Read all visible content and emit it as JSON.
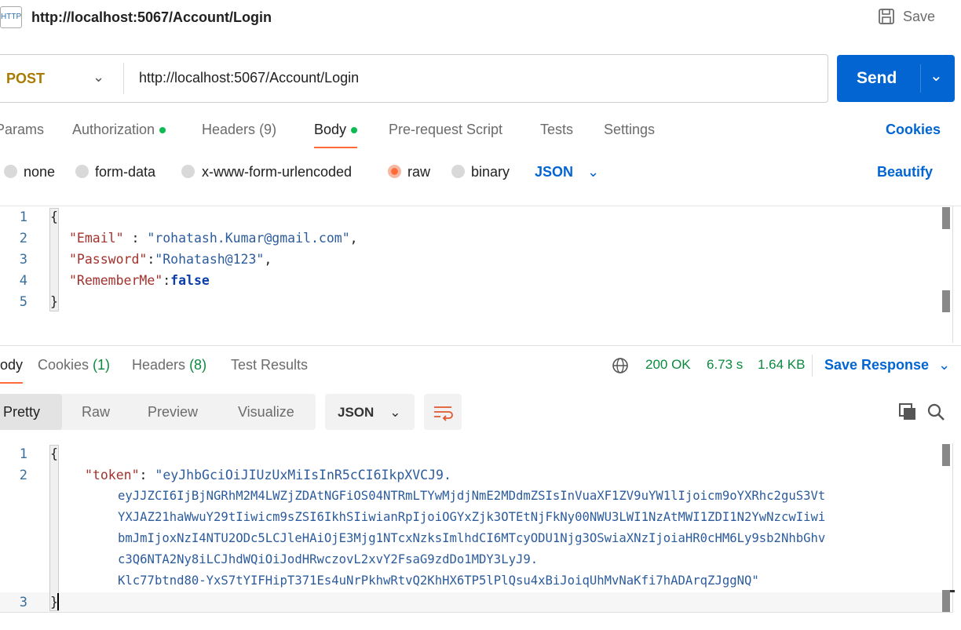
{
  "header": {
    "icon": "http-icon",
    "title": "http://localhost:5067/Account/Login",
    "save_label": "Save"
  },
  "request": {
    "method": "POST",
    "url": "http://localhost:5067/Account/Login",
    "send_label": "Send"
  },
  "tabs": [
    {
      "label": "Params"
    },
    {
      "label": "Authorization"
    },
    {
      "label": "Headers",
      "count": "(9)"
    },
    {
      "label": "Body"
    },
    {
      "label": "Pre-request Script"
    },
    {
      "label": "Tests"
    },
    {
      "label": "Settings"
    }
  ],
  "cookies_label": "Cookies",
  "body_types": [
    "none",
    "form-data",
    "x-www-form-urlencoded",
    "raw",
    "binary"
  ],
  "selected_body_type": "raw",
  "format": "JSON",
  "beautify_label": "Beautify",
  "request_body": {
    "line_numbers": [
      "1",
      "2",
      "3",
      "4",
      "5"
    ],
    "lines": [
      {
        "open": "{"
      },
      {
        "key": "\"Email\"",
        "sep": " : ",
        "val": "\"rohatash.Kumar@gmail.com\"",
        "end": ","
      },
      {
        "key": "\"Password\"",
        "sep": ":",
        "val": "\"Rohatash@123\"",
        "end": ","
      },
      {
        "key": "\"RememberMe\"",
        "sep": ":",
        "val": "false",
        "end": ""
      },
      {
        "open": "}"
      }
    ]
  },
  "response": {
    "tabs": [
      {
        "label": "Body"
      },
      {
        "label": "Cookies",
        "count": "(1)"
      },
      {
        "label": "Headers",
        "count": "(8)"
      },
      {
        "label": "Test Results"
      }
    ],
    "status": "200 OK",
    "time": "6.73 s",
    "size": "1.64 KB",
    "save_response_label": "Save Response",
    "views": [
      "Pretty",
      "Raw",
      "Preview",
      "Visualize"
    ],
    "format": "JSON",
    "line_numbers": [
      "1",
      "2",
      "3"
    ],
    "open": "{",
    "close": "}",
    "token_key": "\"token\"",
    "token_lines": [
      "\"eyJhbGciOiJIUzUxMiIsInR5cCI6IkpXVCJ9.",
      "eyJJZCI6IjBjNGRhM2M4LWZjZDAtNGFiOS04NTRmLTYwMjdjNmE2MDdmZSIsInVuaXF1ZV9uYW1lIjoicm9oYXRhc2guS3Vt",
      "YXJAZ21haWwuY29tIiwicm9sZSI6IkhSIiwianRpIjoiOGYxZjk3OTEtNjFkNy00NWU3LWI1NzAtMWI1ZDI1N2YwNzcwIiwi",
      "bmJmIjoxNzI4NTU2ODc5LCJleHAiOjE3Mjg1NTcxNzksImlhdCI6MTcyODU1Njg3OSwiaXNzIjoiaHR0cHM6Ly9sb2NhbGhv",
      "c3Q6NTA2Ny8iLCJhdWQiOiJodHRwczovL2xvY2FsaG9zdDo1MDY3LyJ9.",
      "Klc77btnd80-YxS7tYIFHipT371Es4uNrPkhwRtvQ2KhHX6TP5lPlQsu4xBiJoiqUhMvNaKfi7hADArqZJggNQ\""
    ]
  },
  "colors": {
    "accent": "#0265d2",
    "method": "#a77b00",
    "active_tab_underline": "#ff6c37",
    "status": "#0b8a3f"
  }
}
